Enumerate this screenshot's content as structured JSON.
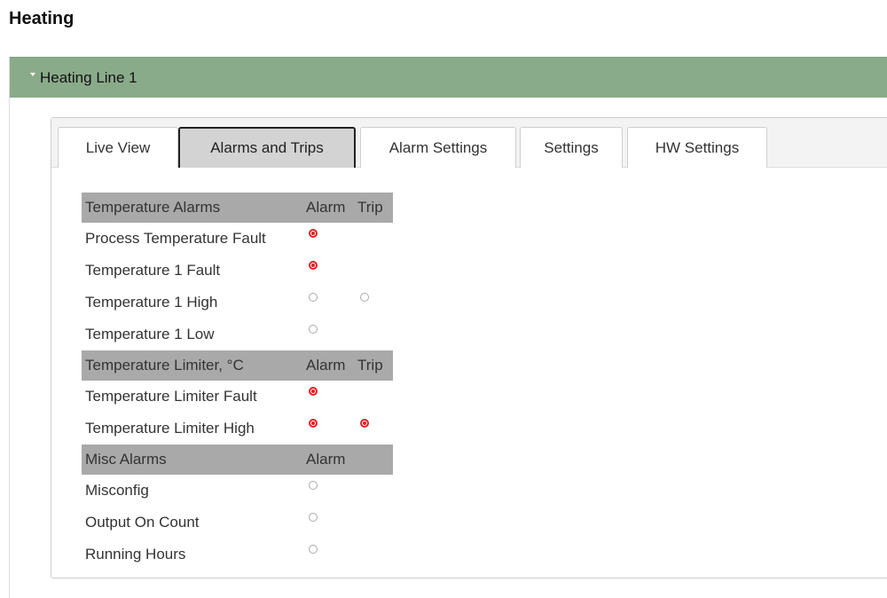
{
  "page": {
    "title": "Heating"
  },
  "panel": {
    "title": "Heating Line 1"
  },
  "tabs": [
    {
      "label": "Live View",
      "active": false
    },
    {
      "label": "Alarms and Trips",
      "active": true
    },
    {
      "label": "Alarm Settings",
      "active": false
    },
    {
      "label": "Settings",
      "active": false
    },
    {
      "label": "HW Settings",
      "active": false
    }
  ],
  "sections": [
    {
      "title": "Temperature Alarms",
      "col1": "Alarm",
      "col2": "Trip",
      "rows": [
        {
          "label": "Process Temperature Fault",
          "alarm": true,
          "trip": null
        },
        {
          "label": "Temperature 1 Fault",
          "alarm": true,
          "trip": null
        },
        {
          "label": "Temperature 1 High",
          "alarm": false,
          "trip": false
        },
        {
          "label": "Temperature 1 Low",
          "alarm": false,
          "trip": null
        }
      ]
    },
    {
      "title": "Temperature Limiter, °C",
      "col1": "Alarm",
      "col2": "Trip",
      "rows": [
        {
          "label": "Temperature Limiter Fault",
          "alarm": true,
          "trip": null
        },
        {
          "label": "Temperature Limiter High",
          "alarm": true,
          "trip": true
        }
      ]
    },
    {
      "title": "Misc Alarms",
      "col1": "Alarm",
      "col2": "",
      "rows": [
        {
          "label": "Misconfig",
          "alarm": false,
          "trip": null
        },
        {
          "label": "Output On Count",
          "alarm": false,
          "trip": null
        },
        {
          "label": "Running Hours",
          "alarm": false,
          "trip": null
        }
      ]
    }
  ],
  "colors": {
    "header_green": "#8aab8a",
    "indicator_red": "#dd2222",
    "section_grey": "#a9a9a9"
  }
}
